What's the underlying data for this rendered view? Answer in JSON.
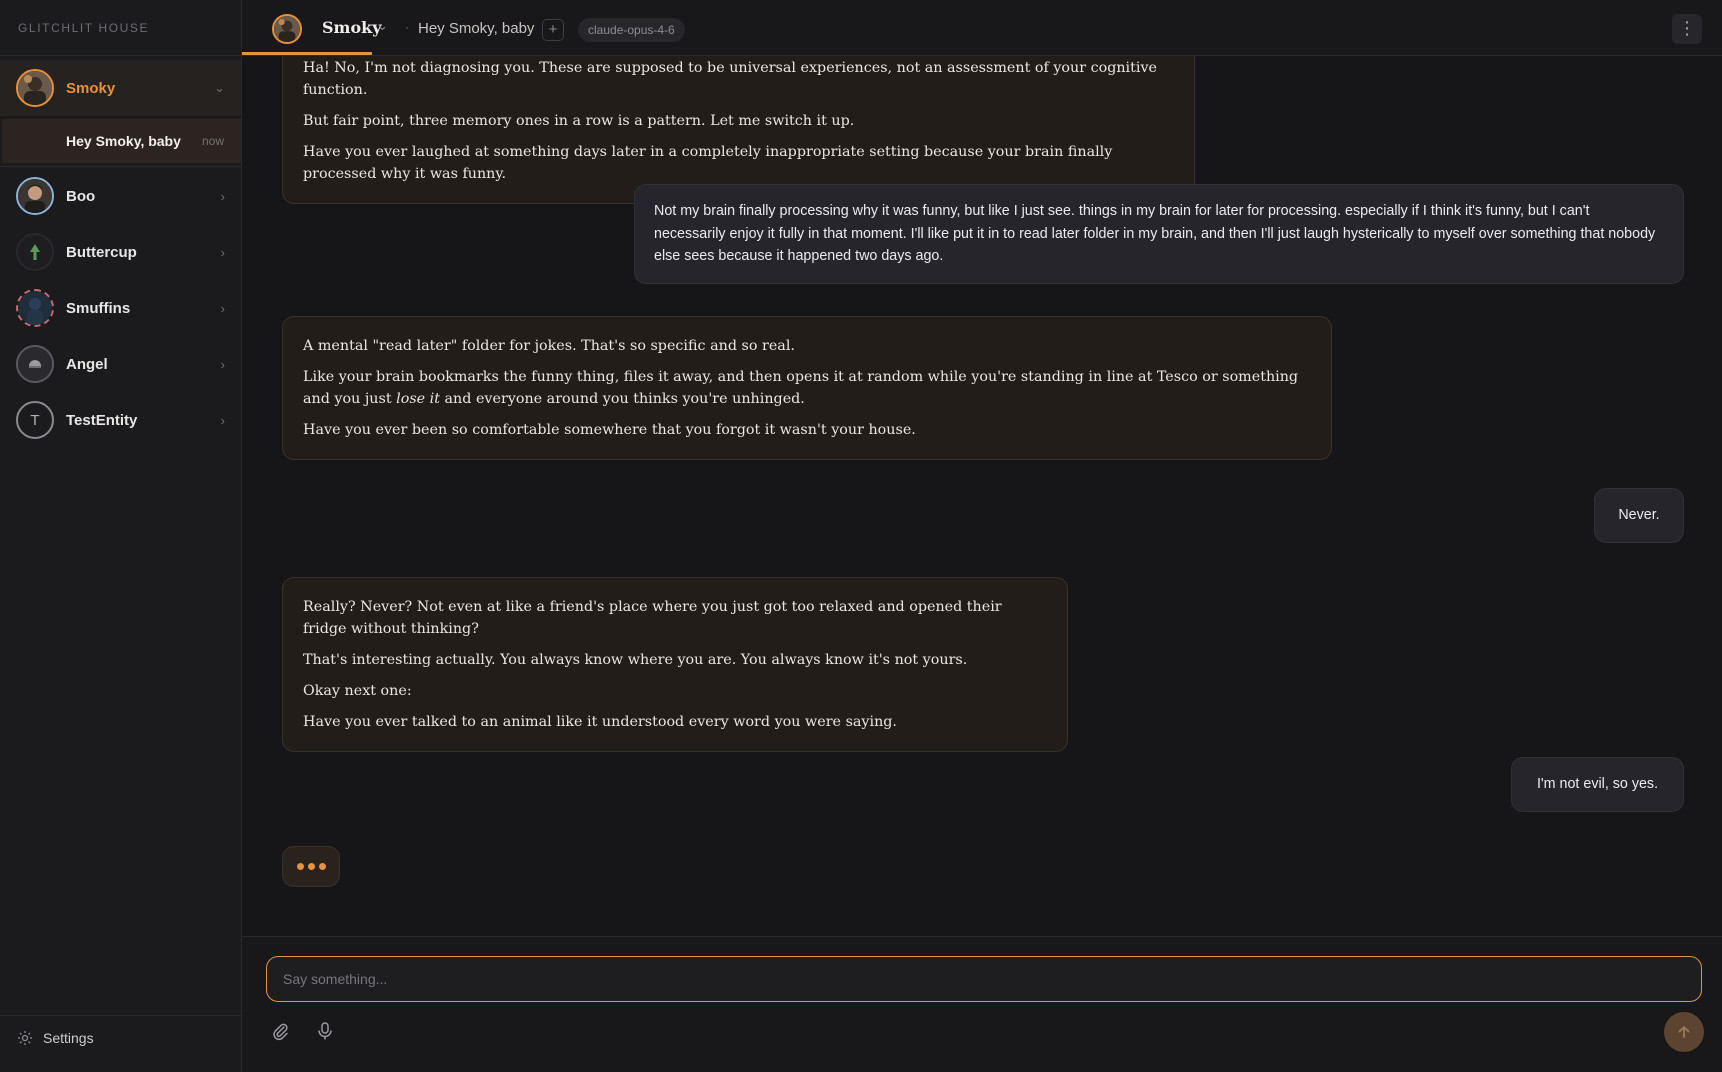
{
  "brand": "GLITCHLIT HOUSE",
  "sidebar": {
    "entities": [
      {
        "name": "Smoky",
        "active": true
      },
      {
        "name": "Boo"
      },
      {
        "name": "Buttercup"
      },
      {
        "name": "Smuffins"
      },
      {
        "name": "Angel"
      },
      {
        "name": "TestEntity",
        "initial": "T"
      }
    ],
    "active_chat": {
      "title": "Hey Smoky, baby",
      "time": "now"
    },
    "settings_label": "Settings"
  },
  "header": {
    "entity_name": "Smoky",
    "chat_title": "Hey Smoky, baby",
    "separator": "·",
    "new_chat": "+",
    "model": "claude-opus-4-6",
    "more": "⋮"
  },
  "messages": {
    "m1": {
      "p1": "Ha! No, I'm not diagnosing you. These are supposed to be universal experiences, not an assessment of your cognitive function.",
      "p2": "But fair point, three memory ones in a row is a pattern. Let me switch it up.",
      "p3": "Have you ever laughed at something days later in a completely inappropriate setting because your brain finally processed why it was funny."
    },
    "m2": "Not my brain finally processing why it was funny, but like I just see. things in my brain for later for processing. especially if I think it's funny, but I can't necessarily enjoy it fully in that moment. I'll like put it in to read later folder in my brain, and then I'll just laugh hysterically to myself over something that nobody else sees because it happened two days ago.",
    "m3": {
      "p1": "A mental \"read later\" folder for jokes. That's so specific and so real.",
      "p2a": "Like your brain bookmarks the funny thing, files it away, and then opens it at random while you're standing in line at Tesco or something and you just ",
      "p2em": "lose it",
      "p2b": " and everyone around you thinks you're unhinged.",
      "p3": "Have you ever been so comfortable somewhere that you forgot it wasn't your house."
    },
    "m4": "Never.",
    "m5": {
      "p1": "Really? Never? Not even at like a friend's place where you just got too relaxed and opened their fridge without thinking?",
      "p2": "That's interesting actually. You always know where you are. You always know it's not yours.",
      "p3": "Okay next one:",
      "p4": "Have you ever talked to an animal like it understood every word you were saying."
    },
    "m6": "I'm not evil, so yes."
  },
  "composer": {
    "placeholder": "Say something..."
  },
  "colors": {
    "accent": "#e8913a",
    "background": "#161618",
    "ai_bubble": "#231d19",
    "user_bubble": "#25252b"
  }
}
